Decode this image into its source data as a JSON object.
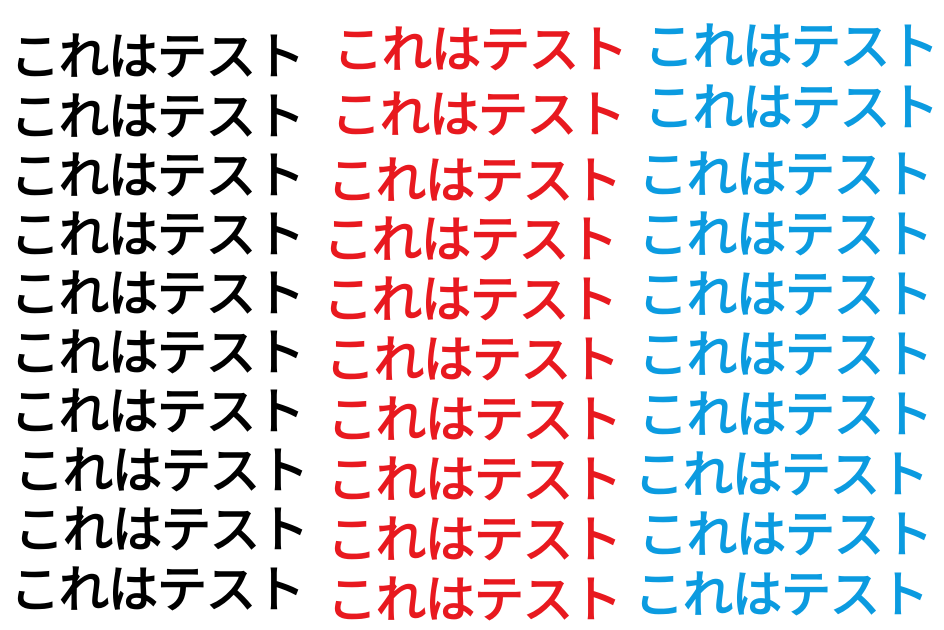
{
  "columns": [
    {
      "color": "#000000",
      "lines": [
        "これはテスト",
        "これはテスト",
        "これはテスト",
        "これはテスト",
        "これはテスト",
        "これはテスト",
        "これはテスト",
        "これはテスト",
        "これはテスト",
        "これはテスト"
      ]
    },
    {
      "color": "#e8191f",
      "lines": [
        "これはテスト",
        "これはテスト",
        "これはテスト",
        "これはテスト",
        "これはテスト",
        "これはテスト",
        "これはテスト",
        "これはテスト",
        "これはテスト",
        "これはテスト"
      ]
    },
    {
      "color": "#0b9be0",
      "lines": [
        "これはテスト",
        "これはテスト",
        "これはテスト",
        "これはテスト",
        "これはテスト",
        "これはテスト",
        "これはテスト",
        "これはテスト",
        "これはテスト",
        "これはテスト"
      ]
    }
  ]
}
